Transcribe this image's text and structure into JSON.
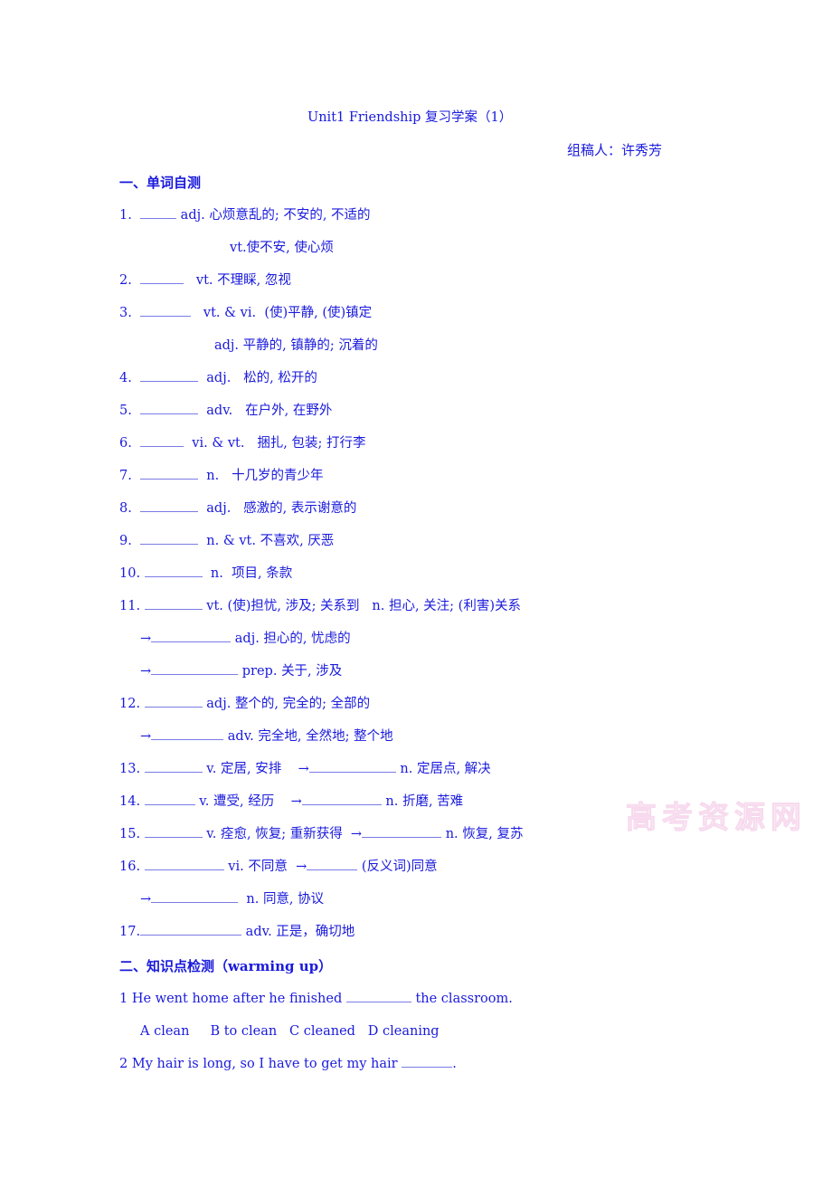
{
  "title": "Unit1 Friendship 复习学案（1）",
  "author": "组稿人：许秀芳",
  "section1": {
    "heading": "一、单词自测",
    "items": [
      {
        "num": "1.",
        "pos": "adj.",
        "meaning": "心烦意乱的; 不安的, 不适的",
        "sub": "vt.使不安, 使心烦"
      },
      {
        "num": "2.",
        "pos": "vt.",
        "meaning": "不理睬, 忽视"
      },
      {
        "num": "3.",
        "pos": "vt. & vi.",
        "meaning": "(使)平静, (使)镇定",
        "sub": "adj. 平静的, 镇静的; 沉着的"
      },
      {
        "num": "4.",
        "pos": "adj.",
        "meaning": "松的, 松开的"
      },
      {
        "num": "5.",
        "pos": "adv.",
        "meaning": "在户外, 在野外"
      },
      {
        "num": "6.",
        "pos": "vi. & vt.",
        "meaning": "捆扎, 包装; 打行李"
      },
      {
        "num": "7.",
        "pos": "n.",
        "meaning": "十几岁的青少年"
      },
      {
        "num": "8.",
        "pos": "adj.",
        "meaning": "感激的, 表示谢意的"
      },
      {
        "num": "9.",
        "pos": "n. & vt.",
        "meaning": "不喜欢, 厌恶"
      },
      {
        "num": "10.",
        "pos": "n.",
        "meaning": "项目, 条款"
      },
      {
        "num": "11.",
        "pos": "vt.",
        "meaning": "(使)担忧, 涉及; 关系到",
        "pos2": "n.",
        "meaning2": "担心, 关注; (利害)关系",
        "derived": [
          {
            "pos": "adj.",
            "meaning": "担心的, 忧虑的"
          },
          {
            "pos": "prep.",
            "meaning": "关于, 涉及"
          }
        ]
      },
      {
        "num": "12.",
        "pos": "adj.",
        "meaning": "整个的, 完全的; 全部的",
        "derived": [
          {
            "pos": "adv.",
            "meaning": "完全地, 全然地; 整个地"
          }
        ]
      },
      {
        "num": "13.",
        "pos": "v.",
        "meaning": "定居, 安排",
        "arrow_pos": "n.",
        "arrow_meaning": "定居点, 解决"
      },
      {
        "num": "14.",
        "pos": "v.",
        "meaning": "遭受, 经历",
        "arrow_pos": "n.",
        "arrow_meaning": "折磨, 苦难"
      },
      {
        "num": "15.",
        "pos": "v.",
        "meaning": "痊愈, 恢复; 重新获得",
        "arrow_pos": "n.",
        "arrow_meaning": "恢复, 复苏"
      },
      {
        "num": "16.",
        "pos": "vi.",
        "meaning": "不同意",
        "arrow_meaning": "(反义词)同意",
        "derived": [
          {
            "pos": "n.",
            "meaning": "同意, 协议"
          }
        ]
      },
      {
        "num": "17.",
        "pos": "adv.",
        "meaning": "正是，确切地"
      }
    ]
  },
  "section2": {
    "heading": "二、知识点检测（warming up）",
    "questions": [
      {
        "num": "1",
        "before": "He went home after he finished",
        "after": "the classroom.",
        "options": [
          "A clean",
          "B to clean",
          "C cleaned",
          "D cleaning"
        ]
      },
      {
        "num": "2",
        "before": "My hair is long, so I have to get my hair",
        "after": "."
      }
    ]
  },
  "arrow": "→",
  "watermark": "高考资源网",
  "colors": {
    "text": "#1a1adc",
    "blank": "#7b7be6",
    "watermark": "#f4cbe8"
  }
}
